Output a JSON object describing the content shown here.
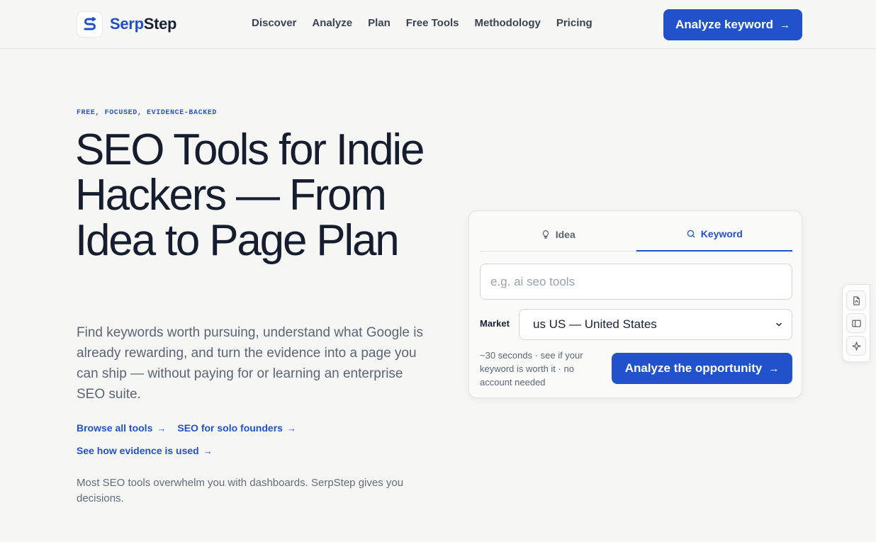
{
  "brand": {
    "name_part1": "Serp",
    "name_part2": "Step",
    "accent_color": "#2152cc"
  },
  "nav": {
    "items": [
      {
        "label": "Discover"
      },
      {
        "label": "Analyze"
      },
      {
        "label": "Plan"
      },
      {
        "label": "Free Tools"
      },
      {
        "label": "Methodology"
      },
      {
        "label": "Pricing"
      }
    ],
    "cta_label": "Analyze keyword",
    "cta_icon": "arrow-right-icon"
  },
  "hero": {
    "eyebrow": "FREE, FOCUSED, EVIDENCE-BACKED",
    "title": "SEO Tools for Indie Hackers — From Idea to Page Plan",
    "subtitle": "Find keywords worth pursuing, understand what Google is already rewarding, and turn the evidence into a page you can ship — without paying for or learning an enterprise SEO suite.",
    "links": [
      {
        "label": "Browse all tools"
      },
      {
        "label": "SEO for solo founders"
      },
      {
        "label": "See how evidence is used"
      }
    ],
    "tagline": "Most SEO tools overwhelm you with dashboards. SerpStep gives you decisions."
  },
  "card": {
    "tabs": [
      {
        "label": "Idea",
        "icon": "lightbulb-icon"
      },
      {
        "label": "Keyword",
        "icon": "search-icon",
        "active": true
      }
    ],
    "input_placeholder": "e.g. ai seo tools",
    "input_value": "",
    "market_label": "Market",
    "market_value": "us US — United States",
    "hint": "~30 seconds · see if your keyword is worth it · no account needed",
    "cta_label": "Analyze the opportunity"
  },
  "side_toolbar": {
    "icons": [
      "document-icon",
      "sidebar-panel-icon",
      "sparkle-icon"
    ]
  }
}
